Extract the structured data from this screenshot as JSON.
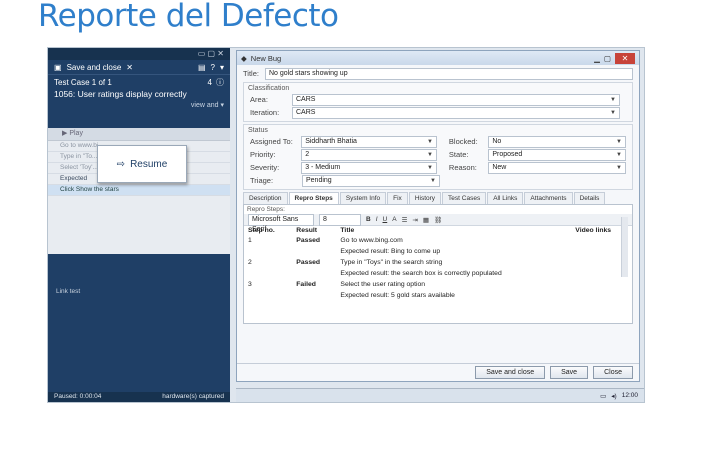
{
  "slide": {
    "title": "Reporte del Defecto"
  },
  "runner": {
    "toolbar_left": "Save and close",
    "toolbar_right": "?",
    "test_case": "Test Case 1 of 1",
    "counter": "4",
    "title": "1056: User ratings display correctly",
    "view_link": "view and ▾",
    "steps_toolbar": "Play",
    "steps": [
      {
        "text": "Go to www.bi...",
        "kind": "normal"
      },
      {
        "text": "Type in \"To...\"",
        "kind": "normal"
      },
      {
        "text": "Select 'Toy'...",
        "kind": "normal"
      },
      {
        "text": "Expected",
        "kind": "exp"
      },
      {
        "text": "Click Show the stars",
        "kind": "sel"
      }
    ],
    "resume_label": "Resume",
    "link_test": "Link test",
    "footer_left": "Paused: 0:00:04",
    "footer_right": "hardware(s) captured"
  },
  "dialog": {
    "window_title": "New Bug",
    "title_label": "Title:",
    "title_value": "No gold stars showing up",
    "classification_label": "Classification",
    "area_label": "Area:",
    "area_value": "CARS",
    "iteration_label": "Iteration:",
    "iteration_value": "CARS",
    "status_label": "Status",
    "assigned_label": "Assigned To:",
    "assigned_value": "Siddharth Bhatia",
    "blocked_label": "Blocked:",
    "blocked_value": "No",
    "priority_label": "Priority:",
    "priority_value": "2",
    "state_label": "State:",
    "state_value": "Proposed",
    "severity_label": "Severity:",
    "severity_value": "3 - Medium",
    "reason_label": "Reason:",
    "reason_value": "New",
    "triage_label": "Triage:",
    "triage_value": "Pending",
    "tabs": [
      {
        "label": "Description",
        "active": false
      },
      {
        "label": "Repro Steps",
        "active": true
      },
      {
        "label": "System Info",
        "active": false
      },
      {
        "label": "Fix",
        "active": false
      },
      {
        "label": "History",
        "active": false
      },
      {
        "label": "Test Cases",
        "active": false
      },
      {
        "label": "All Links",
        "active": false
      },
      {
        "label": "Attachments",
        "active": false
      },
      {
        "label": "Details",
        "active": false
      }
    ],
    "repro_label": "Repro Steps:",
    "font_name": "Microsoft Sans Serif",
    "font_size": "8",
    "columns": {
      "step": "Step no.",
      "result": "Result",
      "title": "Title",
      "video": "Video links"
    },
    "rows": [
      {
        "step": "1",
        "result": "Passed",
        "status": "pass",
        "title": "Go to www.bing.com"
      },
      {
        "step": "",
        "result": "",
        "status": "",
        "title": "Expected result: Bing to come up"
      },
      {
        "step": "2",
        "result": "Passed",
        "status": "pass",
        "title": "Type in \"Toys\" in the search string"
      },
      {
        "step": "",
        "result": "",
        "status": "",
        "title": "Expected result: the search box is correctly populated"
      },
      {
        "step": "3",
        "result": "Failed",
        "status": "fail",
        "title": "Select the user rating option"
      },
      {
        "step": "",
        "result": "",
        "status": "",
        "title": "Expected result: 5 gold stars available"
      }
    ],
    "buttons": {
      "save_close": "Save and close",
      "save": "Save",
      "close": "Close"
    }
  },
  "taskbar": {
    "clock": "12:00"
  }
}
